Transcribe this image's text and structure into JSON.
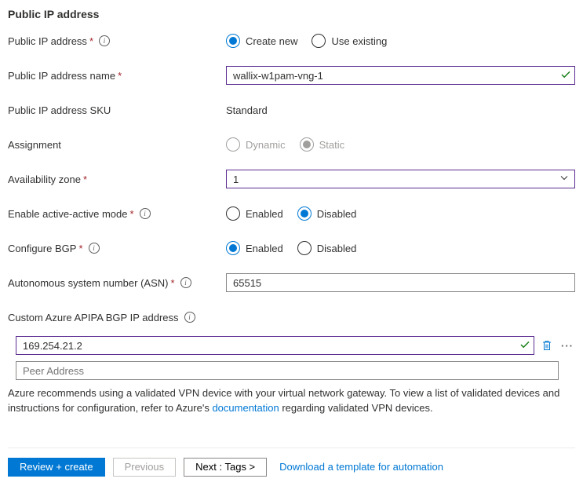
{
  "section_title": "Public IP address",
  "labels": {
    "public_ip": "Public IP address",
    "public_ip_name": "Public IP address name",
    "public_ip_sku": "Public IP address SKU",
    "assignment": "Assignment",
    "availability_zone": "Availability zone",
    "active_active": "Enable active-active mode",
    "configure_bgp": "Configure BGP",
    "asn": "Autonomous system number (ASN)",
    "apipa": "Custom Azure APIPA BGP IP address"
  },
  "options": {
    "create_new": "Create new",
    "use_existing": "Use existing",
    "dynamic": "Dynamic",
    "static": "Static",
    "enabled": "Enabled",
    "disabled": "Disabled"
  },
  "values": {
    "public_ip_name": "wallix-w1pam-vng-1",
    "public_ip_sku": "Standard",
    "availability_zone": "1",
    "asn": "65515",
    "apipa_ip": "169.254.21.2"
  },
  "placeholders": {
    "peer": "Peer Address"
  },
  "note": {
    "part1": "Azure recommends using a validated VPN device with your virtual network gateway. To view a list of validated devices and instructions for configuration, refer to Azure's ",
    "link": "documentation",
    "part2": " regarding validated VPN devices."
  },
  "footer": {
    "review": "Review + create",
    "previous": "Previous",
    "next": "Next : Tags >",
    "template_link": "Download a template for automation"
  }
}
